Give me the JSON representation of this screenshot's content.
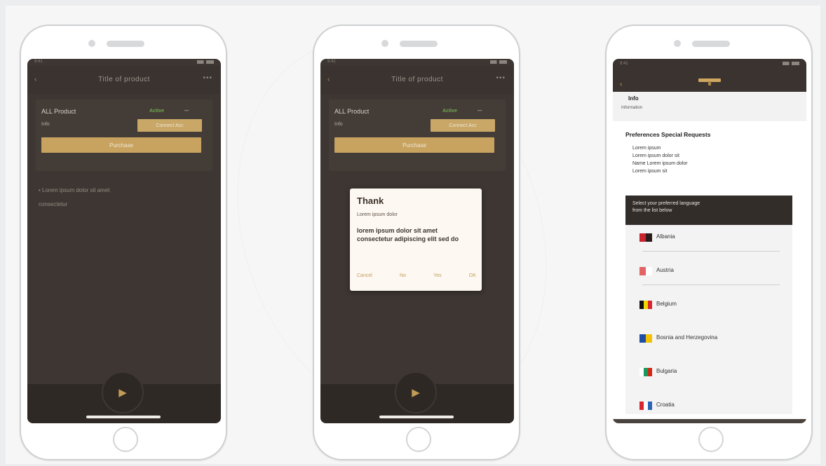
{
  "phones": [
    {
      "status_time": "9:41",
      "nav": {
        "back": "‹",
        "title": "Title of product",
        "menu": "•••"
      },
      "account": {
        "name": "ALL Product",
        "status": "Active",
        "extra": "•••",
        "sub": "Info",
        "button_small": "Connect Acc",
        "button_wide": "Purchase"
      },
      "bullets": [
        "• Lorem ipsum dolor sit amet",
        "consectetur"
      ],
      "fab_icon": "▶"
    },
    {
      "status_time": "9:41",
      "nav": {
        "back": "‹",
        "title": "Title of product",
        "menu": "•••"
      },
      "account": {
        "name": "ALL Product",
        "status": "Active",
        "extra": "•••",
        "sub": "Info",
        "button_small": "Connect Acc",
        "button_wide": "Purchase"
      },
      "dialog": {
        "title": "Thank",
        "subtitle": "Lorem ipsum dolor",
        "body": "lorem ipsum dolor sit amet consectetur adipiscing elit sed do",
        "actions": [
          "Cancel",
          "No",
          "Yes",
          "OK"
        ]
      },
      "fab_icon": "▶"
    },
    {
      "status_time": "9:41",
      "crumb": {
        "title": "Info",
        "subtitle": "Information"
      },
      "heading": "Preferences Special Requests",
      "lines": [
        "Lorem ipsum",
        "Lorem ipsum dolor sit",
        "Name Lorem ipsum dolor",
        "Lorem ipsum sit"
      ],
      "selector": [
        "Select your preferred language",
        "from the list below"
      ],
      "countries": [
        "Albania",
        "Austria",
        "Belgium",
        "Bosnia and Herzegovina",
        "Bulgaria",
        "Croatia"
      ],
      "flag_colors": [
        [
          "#c8232c",
          "#2b1a1a"
        ],
        [
          "#e46464",
          "#ffffff"
        ],
        [
          "#111111",
          "#f3d500",
          "#d7262e"
        ],
        [
          "#1e4ea3",
          "#f2c200"
        ],
        [
          "#ffffff",
          "#159b5e",
          "#d62612"
        ],
        [
          "#d9262e",
          "#ffffff",
          "#2b63b5"
        ]
      ]
    }
  ]
}
